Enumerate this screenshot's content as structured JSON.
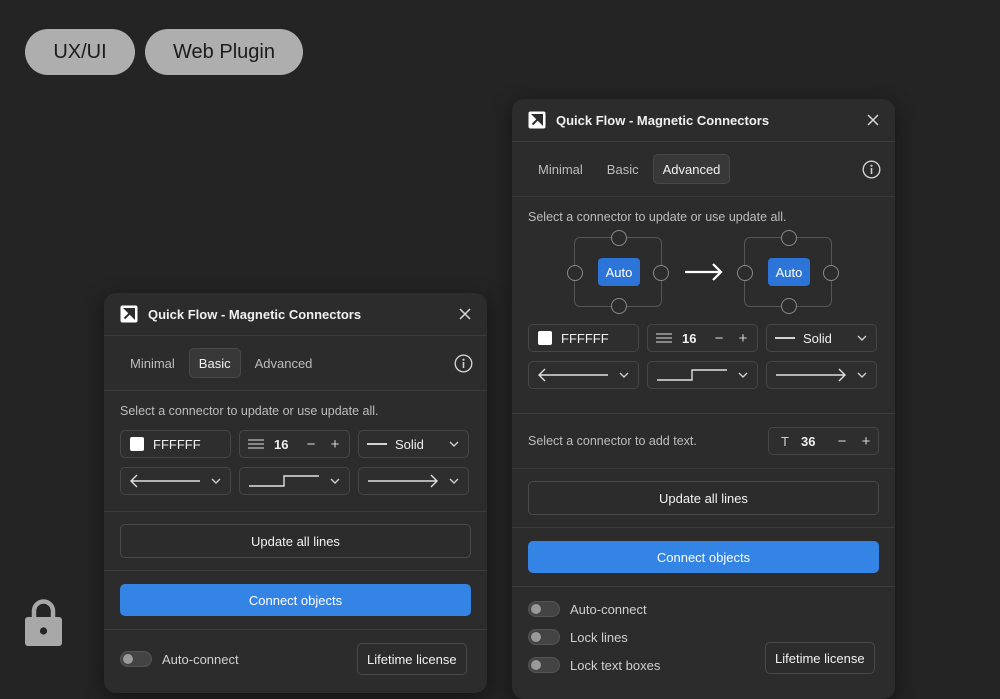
{
  "tags": [
    "UX/UI",
    "Web Plugin"
  ],
  "colors": {
    "accent": "#3484e6",
    "chip": "#2d74d8",
    "panel": "#2c2c2c",
    "background": "#242424"
  },
  "basic_panel": {
    "title": "Quick Flow - Magnetic Connectors",
    "tabs": [
      "Minimal",
      "Basic",
      "Advanced"
    ],
    "active_tab": "Basic",
    "hint": "Select a connector to update or use update all.",
    "color_value": "FFFFFF",
    "stroke_width": "16",
    "stroke_style": "Solid",
    "update_all_label": "Update all lines",
    "connect_label": "Connect objects",
    "toggles": [
      {
        "label": "Auto-connect",
        "on": false
      }
    ],
    "license_label": "Lifetime license"
  },
  "advanced_panel": {
    "title": "Quick Flow - Magnetic Connectors",
    "tabs": [
      "Minimal",
      "Basic",
      "Advanced"
    ],
    "active_tab": "Advanced",
    "hint": "Select a connector to update or use update all.",
    "node_left_label": "Auto",
    "node_right_label": "Auto",
    "color_value": "FFFFFF",
    "stroke_width": "16",
    "stroke_style": "Solid",
    "text_hint": "Select a connector to add text.",
    "text_icon": "T",
    "text_size": "36",
    "update_all_label": "Update all lines",
    "connect_label": "Connect objects",
    "toggles": [
      {
        "label": "Auto-connect",
        "on": false
      },
      {
        "label": "Lock lines",
        "on": false
      },
      {
        "label": "Lock text boxes",
        "on": false
      }
    ],
    "license_label": "Lifetime license"
  },
  "symbols": {
    "minus": "−",
    "plus": "+"
  },
  "icons": [
    "logo-icon",
    "close-icon",
    "info-icon",
    "chevron-down-icon",
    "line-weight-icon",
    "arrow-start-icon",
    "elbow-line-icon",
    "arrow-end-icon",
    "arrow-right-icon",
    "lock-icon"
  ]
}
